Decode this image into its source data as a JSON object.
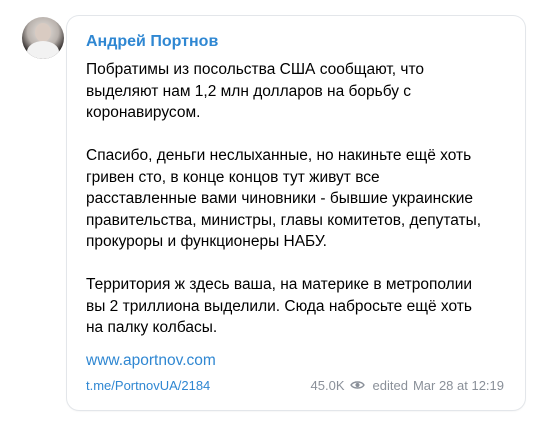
{
  "post": {
    "author": "Андрей Портнов",
    "paragraphs": [
      "Побратимы из посольства США сообщают, что\nвыделяют нам 1,2 млн долларов на борьбу с\nкоронавирусом.",
      "Спасибо, деньги неслыханные, но накиньте ещё хоть\nгривен сто, в конце концов тут живут все\nрасставленные вами чиновники - бывшие украинские\nправительства, министры, главы комитетов, депутаты,\nпрокуроры и функционеры НАБУ.",
      "Территория ж здесь ваша, на материке в метрополии\nвы 2 триллиона выделили. Сюда набросьте ещё хоть\nна палку колбасы."
    ],
    "link_text": "www.aportnov.com",
    "post_link": "t.me/PortnovUA/2184",
    "views": "45.0K",
    "edited_label": "edited",
    "date_time": "Mar 28 at 12:19"
  },
  "icons": {
    "views": "eye-icon"
  },
  "colors": {
    "accent": "#2f87d2",
    "meta": "#8a9099",
    "border": "#e3e6ea"
  }
}
